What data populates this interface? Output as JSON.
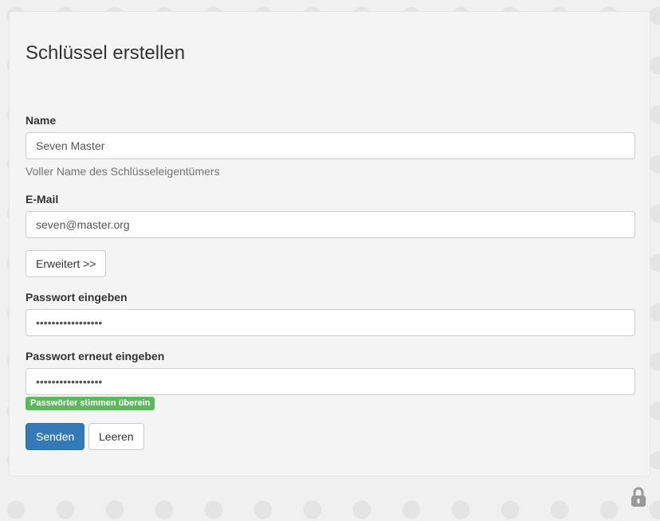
{
  "form": {
    "title": "Schlüssel erstellen",
    "name_label": "Name",
    "name_value": "Seven Master",
    "name_help": "Voller Name des Schlüsseleigentümers",
    "email_label": "E-Mail",
    "email_value": "seven@master.org",
    "advanced_button": "Erweitert >>",
    "password_label": "Passwort eingeben",
    "password_value": "•••••••••••••••••",
    "password_repeat_label": "Passwort erneut eingeben",
    "password_repeat_value": "•••••••••••••••••",
    "match_badge": "Passwörter stimmen überein",
    "submit_button": "Senden",
    "reset_button": "Leeren"
  },
  "icons": {
    "lock": "lock-icon"
  },
  "colors": {
    "primary": "#337ab7",
    "success": "#5cb85c"
  }
}
